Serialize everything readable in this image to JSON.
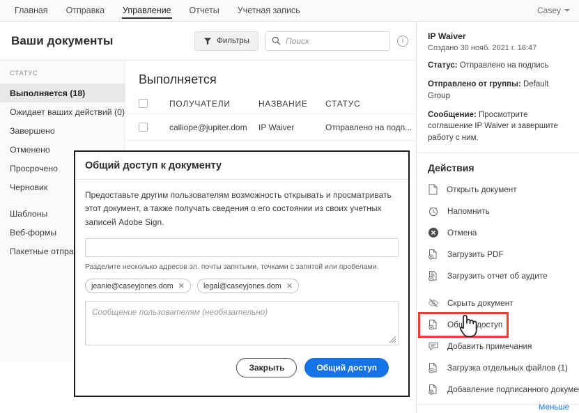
{
  "topnav": {
    "items": [
      {
        "label": "Главная",
        "active": false
      },
      {
        "label": "Отправка",
        "active": false
      },
      {
        "label": "Управление",
        "active": true
      },
      {
        "label": "Отчеты",
        "active": false
      },
      {
        "label": "Учетная запись",
        "active": false
      }
    ],
    "user": "Casey"
  },
  "page": {
    "title": "Ваши документы",
    "filters_label": "Фильтры",
    "search_placeholder": "Поиск",
    "info_glyph": "i"
  },
  "sidebar": {
    "section_label": "СТАТУС",
    "items": [
      {
        "label": "Выполняется (18)",
        "selected": true
      },
      {
        "label": "Ожидает ваших действий (0)",
        "selected": false
      },
      {
        "label": "Завершено",
        "selected": false
      },
      {
        "label": "Отменено",
        "selected": false
      },
      {
        "label": "Просрочено",
        "selected": false
      },
      {
        "label": "Черновик",
        "selected": false
      }
    ],
    "items2": [
      {
        "label": "Шаблоны"
      },
      {
        "label": "Веб-формы"
      },
      {
        "label": "Пакетные отправк"
      }
    ]
  },
  "list": {
    "title": "Выполняется",
    "columns": [
      "ПОЛУЧАТЕЛИ",
      "НАЗВАНИЕ",
      "СТАТУС"
    ],
    "rows": [
      {
        "recipients": "calliope@jupiter.dom",
        "name": "IP Waiver",
        "status": "Отправлено на подп..."
      }
    ]
  },
  "rightpanel": {
    "doc_title": "IP Waiver",
    "created": "Создано 30 нояб. 2021 г. 16:47",
    "status_label": "Статус:",
    "status_value": "Отправлено на подпись",
    "group_label": "Отправлено от группы:",
    "group_value": "Default Group",
    "message_label": "Сообщение:",
    "message_value": "Просмотрите соглашение IP Waiver и завершите работу с ним.",
    "actions_title": "Действия",
    "actions": [
      {
        "label": "Открыть документ",
        "icon": "document-icon",
        "highlighted": false,
        "gap": false
      },
      {
        "label": "Напомнить",
        "icon": "alarm-clock-icon",
        "highlighted": false,
        "gap": false
      },
      {
        "label": "Отмена",
        "icon": "cancel-circle-icon",
        "highlighted": false,
        "gap": false
      },
      {
        "label": "Загрузить PDF",
        "icon": "download-pdf-icon",
        "highlighted": false,
        "gap": false
      },
      {
        "label": "Загрузить отчет об аудите",
        "icon": "audit-report-icon",
        "highlighted": false,
        "gap": false
      },
      {
        "label": "Скрыть документ",
        "icon": "eye-hidden-icon",
        "highlighted": false,
        "gap": true
      },
      {
        "label": "Общий доступ",
        "icon": "share-document-icon",
        "highlighted": true,
        "gap": false
      },
      {
        "label": "Добавить примечания",
        "icon": "note-icon",
        "highlighted": false,
        "gap": false
      },
      {
        "label": "Загрузка отдельных файлов (1)",
        "icon": "download-files-icon",
        "highlighted": false,
        "gap": false
      },
      {
        "label": "Добавление подписанного документа",
        "icon": "add-signed-doc-icon",
        "highlighted": false,
        "gap": false
      }
    ],
    "less_label": "Меньше"
  },
  "modal": {
    "title": "Общий доступ к документу",
    "description": "Предоставьте другим пользователям возможность открывать и просматривать этот документ, а также получать сведения о его состоянии из своих учетных записей Adobe Sign.",
    "email_value": "",
    "hint": "Разделите несколько адресов эл. почты запятыми, точками с запятой или пробелами.",
    "chips": [
      {
        "email": "jeanie@caseyjones.dom",
        "remove": "✕"
      },
      {
        "email": "legal@caseyjones.dom",
        "remove": "✕"
      }
    ],
    "message_placeholder": "Сообщение пользователям (необязательно)",
    "message_value": "",
    "close_label": "Закрыть",
    "share_label": "Общий доступ"
  },
  "colors": {
    "accent_blue": "#1473E6",
    "highlight_red": "#EF3B36",
    "nav_bg": "#FAFAFA",
    "sidebar_bg": "#FAFAFA",
    "selected_bg": "#E8E8E8"
  }
}
